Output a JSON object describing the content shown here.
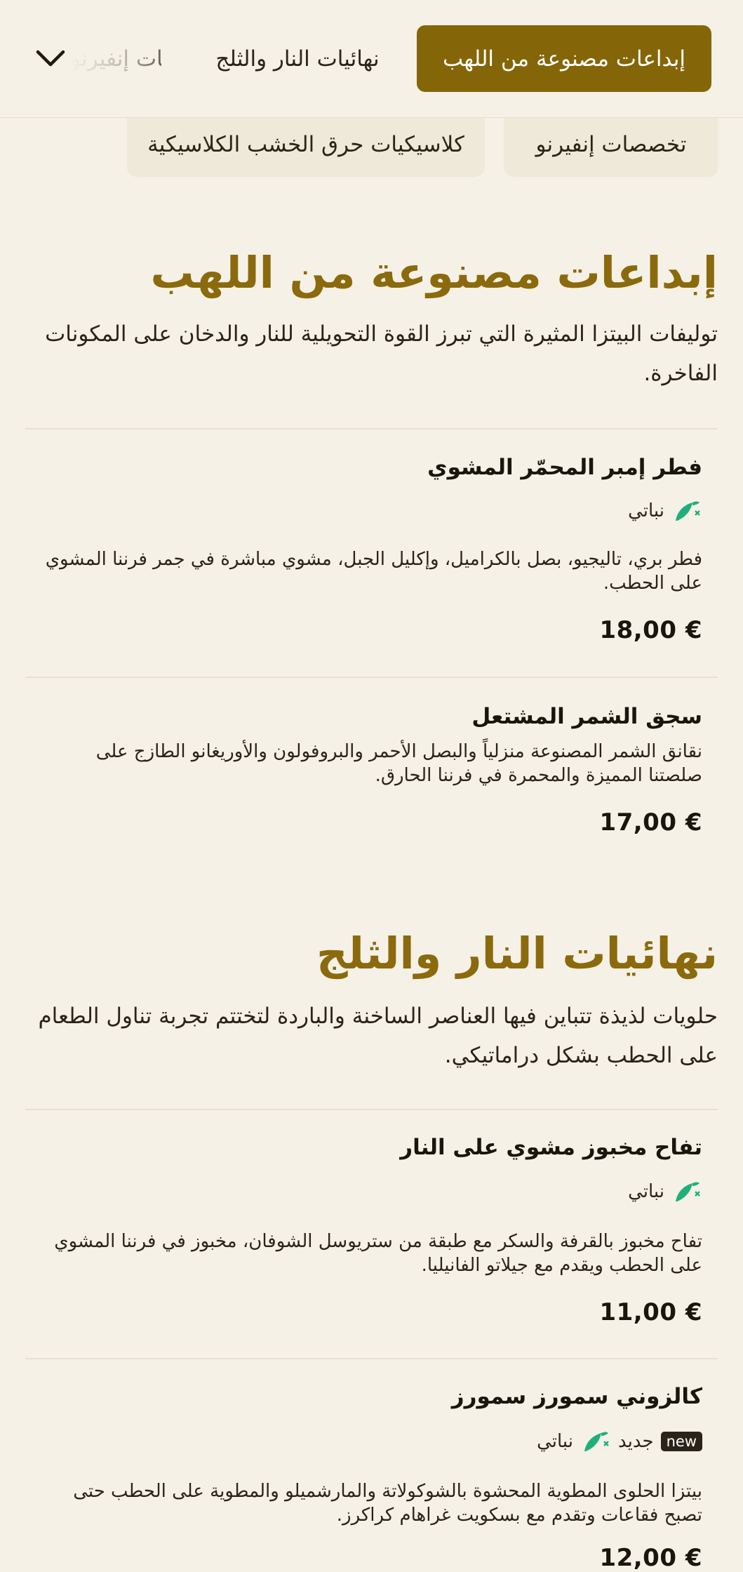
{
  "nav": {
    "tabs": [
      {
        "label": "إبداعات مصنوعة من اللهب",
        "active": true
      },
      {
        "label": "نهائيات النار والثلج",
        "active": false
      },
      {
        "label": "تخصصات إنفيرنو",
        "active": false
      }
    ]
  },
  "pills": [
    {
      "label": "تخصصات إنفيرنو"
    },
    {
      "label": "كلاسيكيات حرق الخشب الكلاسيكية"
    }
  ],
  "sections": [
    {
      "title": "إبداعات مصنوعة من اللهب",
      "description": "توليفات البيتزا المثيرة التي تبرز القوة التحويلية للنار والدخان على المكونات الفاخرة.",
      "items": [
        {
          "name": "فطر إمبر المحمّر المشوي",
          "vegetarian_label": "نباتي",
          "description": "فطر بري، تاليجيو، بصل بالكراميل، وإكليل الجبل، مشوي مباشرة في جمر فرننا المشوي على الحطب.",
          "price": "18,00 €"
        },
        {
          "name": "سجق الشمر المشتعل",
          "description": "نقانق الشمر المصنوعة منزلياً والبصل الأحمر والبروفولون والأوريغانو الطازج على صلصتنا المميزة والمحمرة في فرننا الحارق.",
          "price": "17,00 €"
        }
      ]
    },
    {
      "title": "نهائيات النار والثلج",
      "description": "حلويات لذيذة تتباين فيها العناصر الساخنة والباردة لتختتم تجربة تناول الطعام على الحطب بشكل دراماتيكي.",
      "items": [
        {
          "name": "تفاح مخبوز مشوي على النار",
          "vegetarian_label": "نباتي",
          "description": "تفاح مخبوز بالقرفة والسكر مع طبقة من ستريوسل الشوفان، مخبوز في فرننا المشوي على الحطب ويقدم مع جيلاتو الفانيليا.",
          "price": "11,00 €"
        },
        {
          "name": "كالزوني سمورز سمورز",
          "new_badge": "new",
          "new_label": "جديد",
          "vegetarian_label": "نباتي",
          "description": "بيتزا الحلوى المطوية المحشوة بالشوكولاتة والمارشميلو والمطوية على الحطب حتى تصبح فقاعات وتقدم مع بسكويت غراهام كراكرز.",
          "price": "12,00 €"
        }
      ]
    }
  ],
  "colors": {
    "accent": "#846508",
    "background": "#f6f1e7",
    "veg_icon": "#1fb07a"
  }
}
